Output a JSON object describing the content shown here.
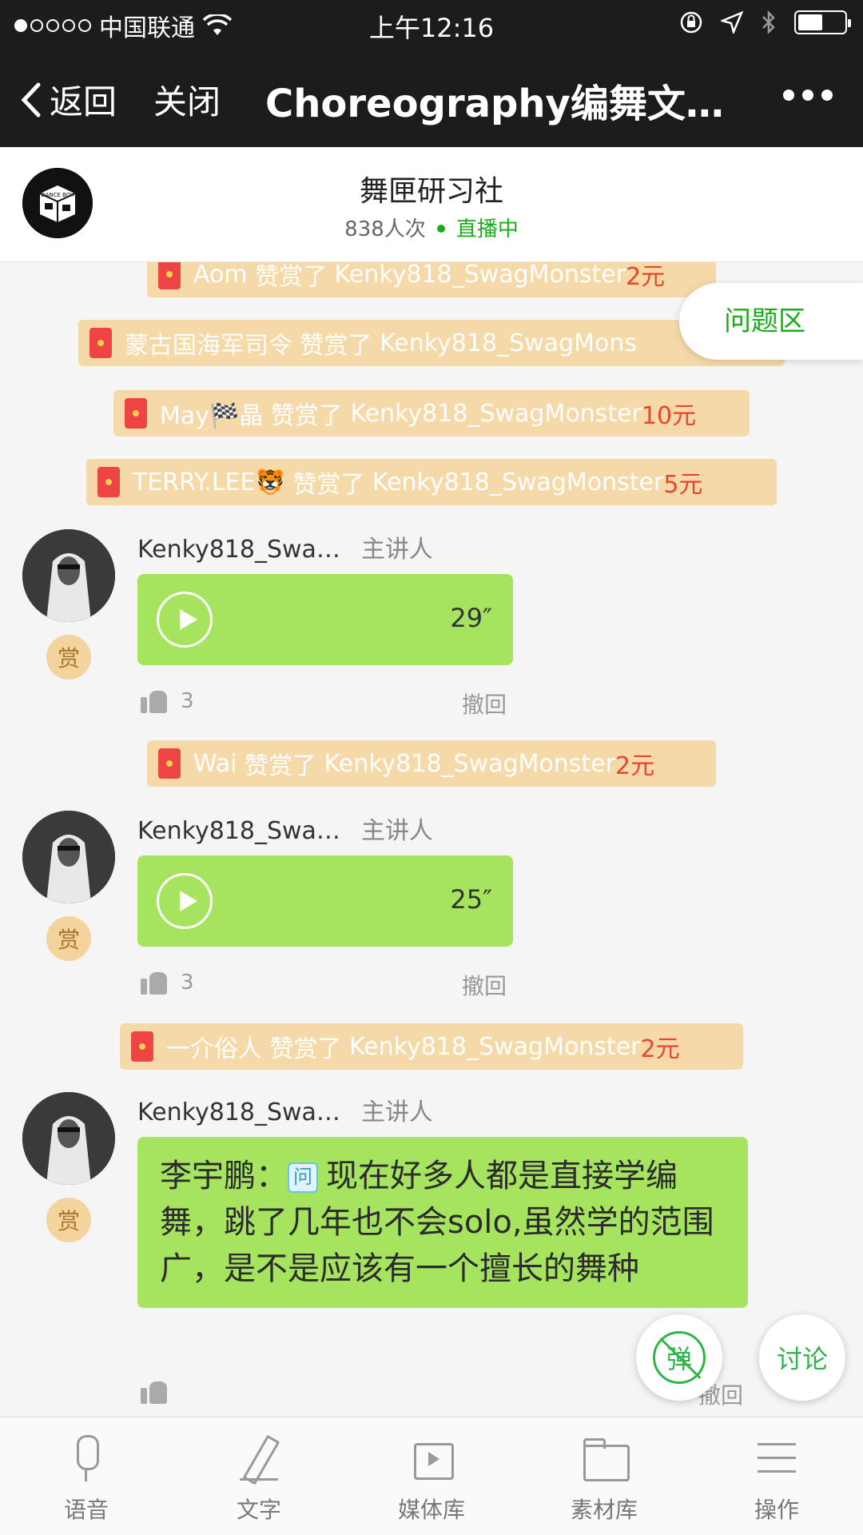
{
  "status_bar": {
    "carrier": "中国联通",
    "time": "上午12:16"
  },
  "nav": {
    "back_label": "返回",
    "close_label": "关闭",
    "title": "Choreography编舞文…"
  },
  "room": {
    "name": "舞匣研习社",
    "viewers": "838人次",
    "live_status": "直播中",
    "logo_text": "DANCE BOX"
  },
  "qa_button": "问题区",
  "rewards": [
    {
      "name": "Aom",
      "verb": "赞赏了",
      "target": "Kenky818_SwagMonster",
      "amount": "2元"
    },
    {
      "name": "蒙古国海军司令",
      "verb": "赞赏了",
      "target": "Kenky818_SwagMons",
      "amount": ""
    },
    {
      "name": "May🏁晶",
      "verb": "赞赏了",
      "target": "Kenky818_SwagMonster",
      "amount": "10元"
    },
    {
      "name": "TERRY.LEE🐯",
      "verb": "赞赏了",
      "target": "Kenky818_SwagMonster",
      "amount": "5元"
    },
    {
      "name": "Wai",
      "verb": "赞赏了",
      "target": "Kenky818_SwagMonster",
      "amount": "2元"
    },
    {
      "name": "一介俗人",
      "verb": "赞赏了",
      "target": "Kenky818_SwagMonster",
      "amount": "2元"
    }
  ],
  "messages": [
    {
      "sender": "Kenky818_Swa…",
      "role": "主讲人",
      "tip": "赏",
      "duration": "29″",
      "likes": "3",
      "recall": "撤回"
    },
    {
      "sender": "Kenky818_Swa…",
      "role": "主讲人",
      "tip": "赏",
      "duration": "25″",
      "likes": "3",
      "recall": "撤回"
    },
    {
      "sender": "Kenky818_Swa…",
      "role": "主讲人",
      "tip": "赏",
      "asker": "李宇鹏：",
      "q_tag": "问",
      "text": "现在好多人都是直接学编舞，跳了几年也不会solo,虽然学的范围广，是不是应该有一个擅长的舞种",
      "recall": "撤回"
    }
  ],
  "fabs": {
    "danmu": "弹",
    "discuss": "讨论"
  },
  "toolbar": [
    {
      "label": "语音",
      "icon": "microphone-icon"
    },
    {
      "label": "文字",
      "icon": "pen-icon"
    },
    {
      "label": "媒体库",
      "icon": "media-icon"
    },
    {
      "label": "素材库",
      "icon": "folder-icon"
    },
    {
      "label": "操作",
      "icon": "menu-icon"
    }
  ],
  "colors": {
    "accent_green": "#1aad19",
    "bubble_green": "#a6e35e",
    "reward_bg": "#f6d9a8",
    "reward_amount": "#e8462b"
  }
}
